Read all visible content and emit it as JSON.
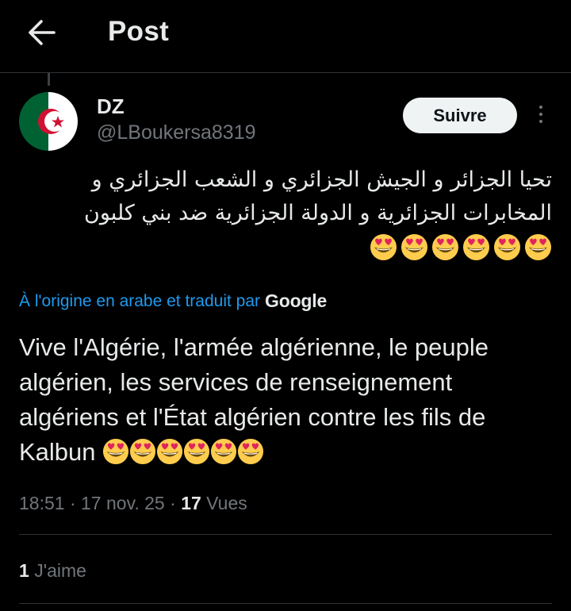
{
  "header": {
    "title": "Post",
    "back_icon": "arrow-left-icon"
  },
  "author": {
    "display_name": "DZ",
    "handle": "@LBoukersa8319",
    "avatar": "algeria-flag-avatar",
    "follow_label": "Suivre",
    "more_icon": "more-vertical-icon"
  },
  "post": {
    "original_text_line1": "تحيا الجزائر و الجيش الجزائري و الشعب الجزائري و",
    "original_text_line2": "المخابرات الجزائرية و الدولة الجزائرية ضد بني كلبون",
    "emoji_count": 6,
    "emoji_name": "heart-eyes-emoji",
    "translation_note": "À l'origine en arabe et traduit par",
    "translation_provider": "Google",
    "translated_text": "Vive l'Algérie, l'armée algérienne, le peuple algérien, les services de renseignement algériens et l'État algérien contre les fils de Kalbun"
  },
  "meta": {
    "time": "18:51",
    "date": "17 nov. 25",
    "views_count": "17",
    "views_label": "Vues"
  },
  "engagement": {
    "likes_count": "1",
    "likes_label": "J'aime"
  },
  "colors": {
    "background": "#000000",
    "text": "#e7e9ea",
    "muted": "#71767b",
    "link": "#1d9bf0",
    "follow_bg": "#eff3f4"
  }
}
